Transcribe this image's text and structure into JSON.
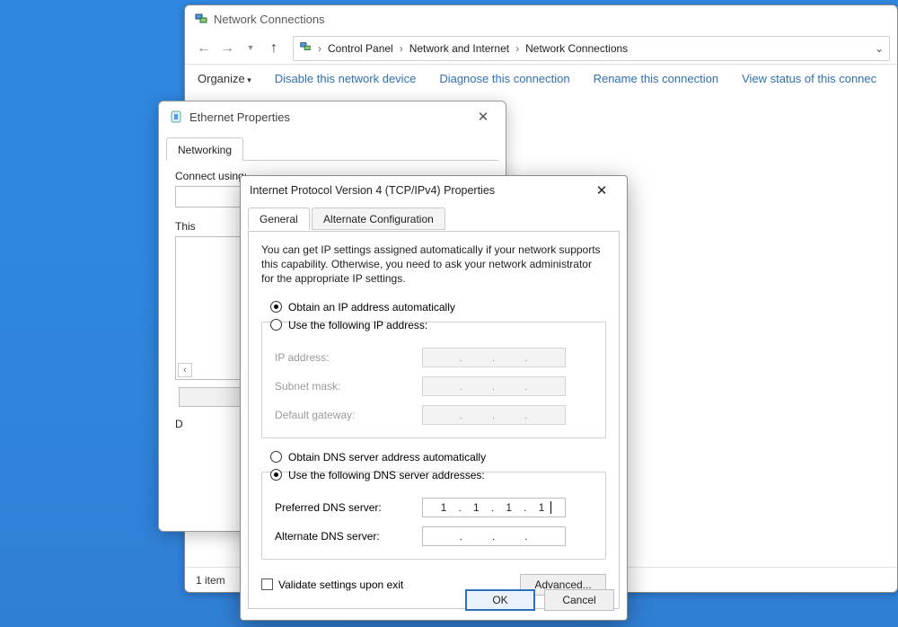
{
  "nc": {
    "title": "Network Connections",
    "breadcrumb": {
      "root_glyph": "🖥",
      "items": [
        "Control Panel",
        "Network and Internet",
        "Network Connections"
      ]
    },
    "toolbar": {
      "organize": "Organize",
      "disable": "Disable this network device",
      "diagnose": "Diagnose this connection",
      "rename": "Rename this connection",
      "viewstatus": "View status of this connec"
    },
    "status": "1 item"
  },
  "eth": {
    "title": "Ethernet Properties",
    "tab_networking": "Networking",
    "connect_using": "Connect using:",
    "items_label": "This"
  },
  "ipv4": {
    "title": "Internet Protocol Version 4 (TCP/IPv4) Properties",
    "tabs": {
      "general": "General",
      "alt": "Alternate Configuration"
    },
    "intro": "You can get IP settings assigned automatically if your network supports this capability. Otherwise, you need to ask your network administrator for the appropriate IP settings.",
    "ip": {
      "auto_label": "Obtain an IP address automatically",
      "manual_label": "Use the following IP address:",
      "selected": "auto",
      "fields": {
        "ip_label": "IP address:",
        "subnet_label": "Subnet mask:",
        "gateway_label": "Default gateway:",
        "values": {
          "ip": [
            "",
            "",
            "",
            ""
          ],
          "subnet": [
            "",
            "",
            "",
            ""
          ],
          "gateway": [
            "",
            "",
            "",
            ""
          ]
        }
      }
    },
    "dns": {
      "auto_label": "Obtain DNS server address automatically",
      "manual_label": "Use the following DNS server addresses:",
      "selected": "manual",
      "fields": {
        "preferred_label": "Preferred DNS server:",
        "alternate_label": "Alternate DNS server:",
        "values": {
          "preferred": [
            "1",
            "1",
            "1",
            "1"
          ],
          "alternate": [
            "",
            "",
            "",
            ""
          ]
        }
      }
    },
    "validate_label": "Validate settings upon exit",
    "validate_checked": false,
    "advanced": "Advanced...",
    "ok": "OK",
    "cancel": "Cancel"
  }
}
